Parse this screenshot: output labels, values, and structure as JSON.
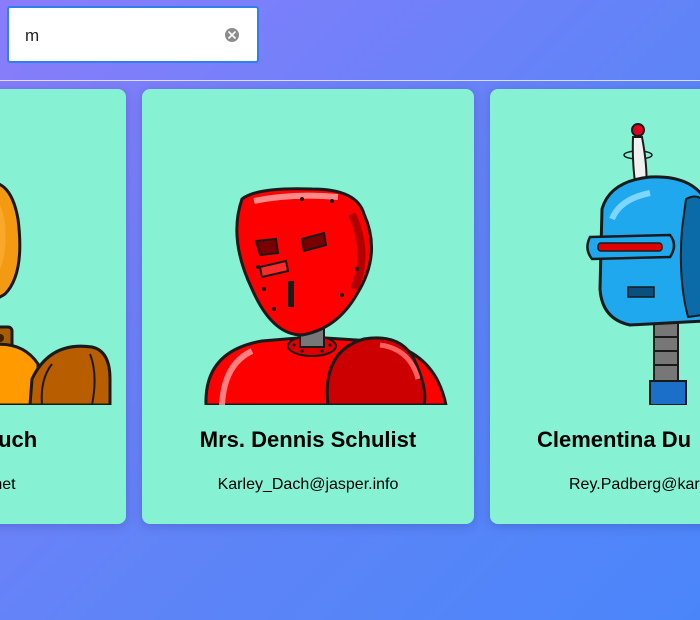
{
  "search": {
    "value": "m",
    "clear_icon": "clear-circle-icon"
  },
  "cards": [
    {
      "name": "Bauch",
      "email": "a.net",
      "portrait": "orange-robot"
    },
    {
      "name": "Mrs. Dennis Schulist",
      "email": "Karley_Dach@jasper.info",
      "portrait": "red-robot"
    },
    {
      "name": "Clementina Du",
      "email": "Rey.Padberg@kari",
      "portrait": "blue-robot"
    }
  ],
  "colors": {
    "card_background": "#86f2d3",
    "search_border": "#2f80ed",
    "background_start": "#8a7cfb",
    "background_end": "#4a86fa"
  }
}
